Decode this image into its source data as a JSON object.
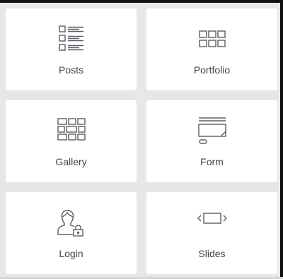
{
  "widgets": [
    {
      "id": "posts",
      "label": "Posts",
      "icon": "posts-icon"
    },
    {
      "id": "portfolio",
      "label": "Portfolio",
      "icon": "portfolio-grid-icon"
    },
    {
      "id": "gallery",
      "label": "Gallery",
      "icon": "gallery-icon"
    },
    {
      "id": "form",
      "label": "Form",
      "icon": "form-icon"
    },
    {
      "id": "login",
      "label": "Login",
      "icon": "login-user-lock-icon"
    },
    {
      "id": "slides",
      "label": "Slides",
      "icon": "slides-icon"
    }
  ],
  "colors": {
    "background": "#e6e7e9",
    "tile": "#ffffff",
    "icon_stroke": "#5a5e64",
    "label": "#3f444b"
  }
}
